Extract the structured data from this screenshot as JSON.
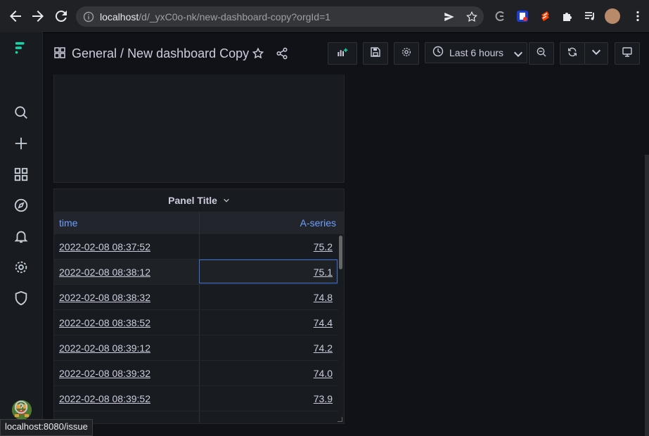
{
  "browser": {
    "url_host": "localhost",
    "url_path": "/d/_yxC0o-nk/new-dashboard-copy?orgId=1",
    "status_tooltip": "localhost:8080/issue"
  },
  "header": {
    "breadcrumb_folder": "General",
    "breadcrumb_sep": " / ",
    "breadcrumb_title": "New dashboard Copy",
    "time_range": "Last 6 hours"
  },
  "panel": {
    "title": "Panel Title",
    "columns": {
      "time": "time",
      "series": "A-series"
    },
    "rows": [
      {
        "time": "2022-02-08 08:37:52",
        "value": "75.2"
      },
      {
        "time": "2022-02-08 08:38:12",
        "value": "75.1"
      },
      {
        "time": "2022-02-08 08:38:32",
        "value": "74.8"
      },
      {
        "time": "2022-02-08 08:38:52",
        "value": "74.4"
      },
      {
        "time": "2022-02-08 08:39:12",
        "value": "74.2"
      },
      {
        "time": "2022-02-08 08:39:32",
        "value": "74.0"
      },
      {
        "time": "2022-02-08 08:39:52",
        "value": "73.9"
      }
    ]
  },
  "colors": {
    "accent": "#6e9fff",
    "focus": "#3d71d9",
    "logo": "#1fd0a6"
  }
}
